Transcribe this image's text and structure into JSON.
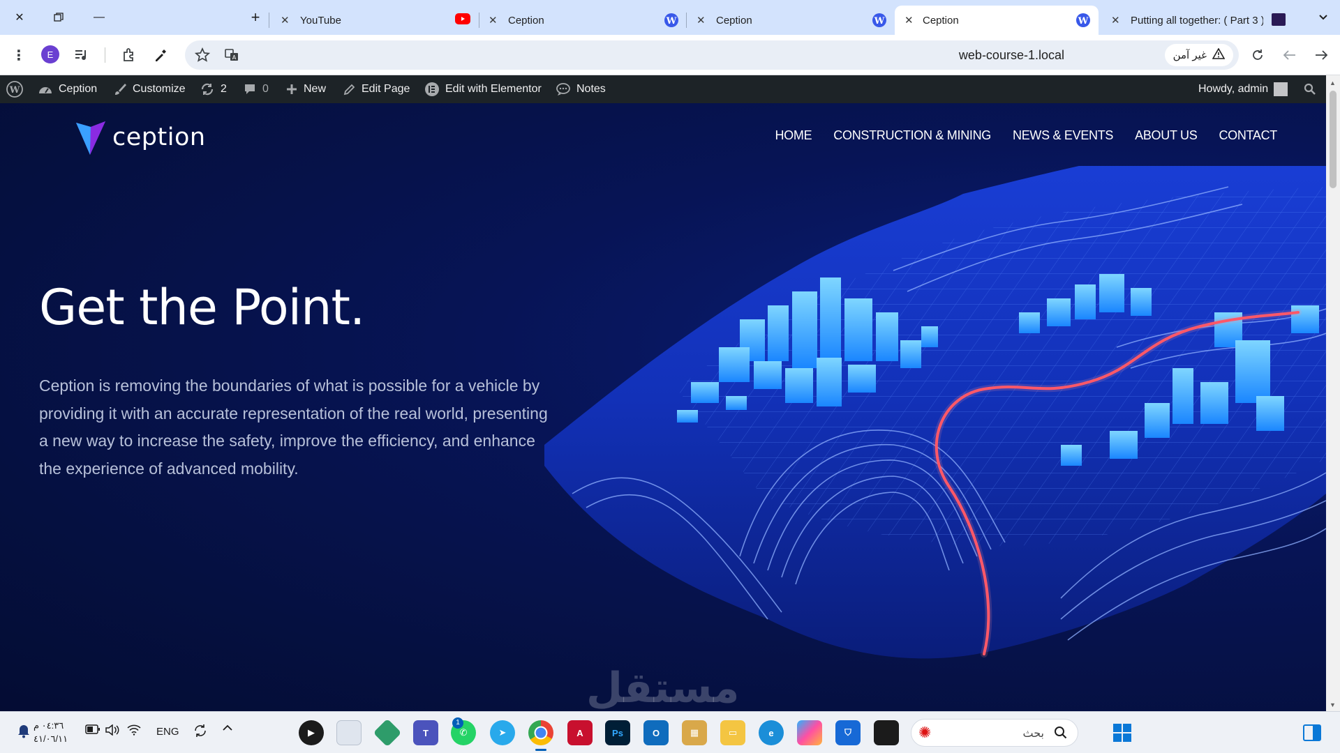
{
  "browser": {
    "tabs": [
      {
        "title": "YouTube",
        "favicon": "youtube-icon",
        "favicon_color": "#ff0000"
      },
      {
        "title": "Ception",
        "favicon": "wordpress-icon",
        "favicon_color": "#3858e9"
      },
      {
        "title": "Ception",
        "favicon": "wordpress-icon",
        "favicon_color": "#3858e9"
      },
      {
        "title": "Ception",
        "favicon": "wordpress-icon",
        "favicon_color": "#3858e9",
        "active": true
      },
      {
        "title": "Putting all together: ( Part 3 ) -",
        "favicon": "purple-app-icon",
        "favicon_color": "#2a1a55"
      }
    ],
    "profile_initial": "E",
    "url": "web-course-1.local",
    "security_label": "غير آمن"
  },
  "adminbar": {
    "site_name": "Ception",
    "customize": "Customize",
    "updates_count": "2",
    "comments_count": "0",
    "new_label": "New",
    "edit_page": "Edit Page",
    "elementor": "Edit with Elementor",
    "notes": "Notes",
    "howdy": "Howdy, admin"
  },
  "site": {
    "logo_text": "ception",
    "nav": [
      "HOME",
      "CONSTRUCTION & MINING",
      "NEWS & EVENTS",
      "ABOUT US",
      "CONTACT"
    ],
    "headline": "Get the Point.",
    "intro": "Ception is removing the boundaries of what is possible for a vehicle by providing it with an accurate representation of the real world, presenting a new way to increase the safety, improve the efficiency, and enhance the experience of advanced mobility.",
    "watermark": "مستقل"
  },
  "taskbar": {
    "time": "٠٤:٣٦ م",
    "date": "٤١/٠٦/١١",
    "language": "ENG",
    "search_placeholder": "بحث",
    "teams_badge": "1"
  },
  "colors": {
    "hero_bg": "#051040",
    "route_line": "#ff4d5e",
    "buildings": "#1e90ff",
    "adminbar_bg": "#1d2327",
    "tabstrip_bg": "#d3e3fd"
  }
}
